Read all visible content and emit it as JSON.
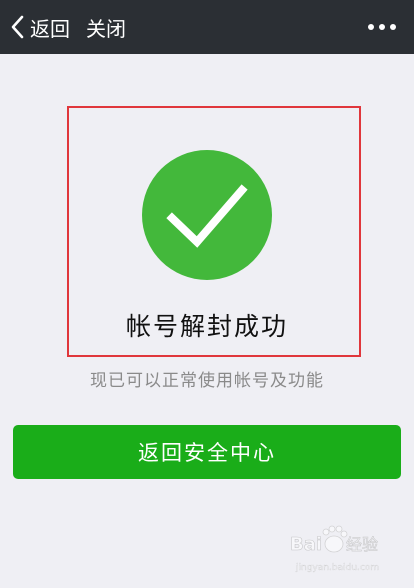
{
  "navbar": {
    "back_label": "返回",
    "close_label": "关闭",
    "back_icon": "chevron-left-icon",
    "more_icon": "more-dots-icon"
  },
  "status": {
    "title": "帐号解封成功",
    "description": "现已可以正常使用帐号及功能",
    "icon": "checkmark-circle-icon",
    "icon_color": "#43b83b"
  },
  "action": {
    "button_label": "返回安全中心",
    "button_color": "#1aad19"
  },
  "watermark": {
    "text": "Baidu 经验",
    "url_text": "jingyan.baidu.com"
  },
  "colors": {
    "navbar_bg": "#2b2f34",
    "page_bg": "#efeff4",
    "highlight_border": "#e0363b"
  }
}
